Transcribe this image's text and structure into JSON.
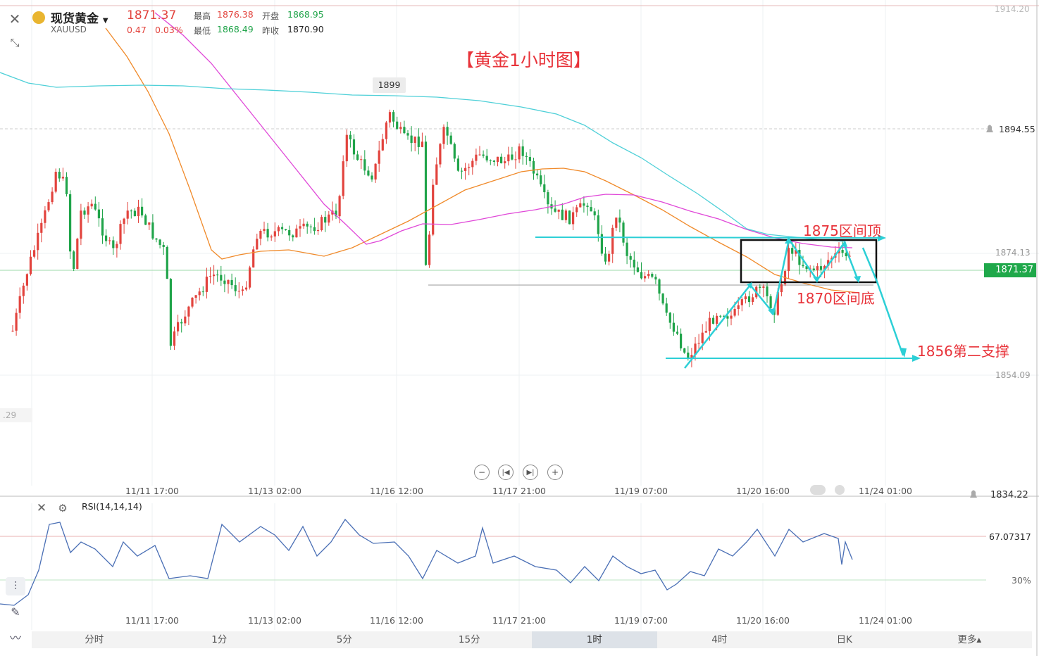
{
  "header": {
    "symbol_name": "现货黄金",
    "symbol_code": "XAUUSD",
    "last_price": "1871.37",
    "change": "0.47",
    "change_pct": "0.03%",
    "high_label": "最高",
    "high_value": "1876.38",
    "open_label": "开盘",
    "open_value": "1868.95",
    "low_label": "最低",
    "low_value": "1868.49",
    "prev_close_label": "昨收",
    "prev_close_value": "1870.90"
  },
  "annotations": {
    "title": "【黄金1小时图】",
    "resistance": "1875区间顶",
    "support": "1870区间底",
    "second_support": "1856第二支撑",
    "peak_tag": "1899",
    "left_tag": ".29"
  },
  "price_axis": {
    "top": "1914.20",
    "alert_level": "1894.55",
    "level_1": "1874.13",
    "current": "1871.37",
    "level_2": "1854.09",
    "bottom": "1834.22"
  },
  "time_axis": [
    "11/11 17:00",
    "11/13 02:00",
    "11/16 12:00",
    "11/17 21:00",
    "11/19 07:00",
    "11/20 16:00",
    "11/24 01:00"
  ],
  "rsi": {
    "title": "RSI(14,14,14)",
    "value": "67.07317",
    "level_label": "30%"
  },
  "tabs": [
    {
      "label": "分时",
      "active": false
    },
    {
      "label": "1分",
      "active": false
    },
    {
      "label": "5分",
      "active": false
    },
    {
      "label": "15分",
      "active": false
    },
    {
      "label": "1时",
      "active": true
    },
    {
      "label": "4时",
      "active": false
    },
    {
      "label": "日K",
      "active": false
    },
    {
      "label": "更多▴",
      "active": false
    }
  ],
  "colors": {
    "up": "#e2433d",
    "down": "#20a44a",
    "ma_orange": "#f08a2a",
    "ma_magenta": "#e048d8",
    "ma_cyan": "#4fd0d8",
    "annotation": "#e8333a",
    "arrow": "#2ccfd6",
    "rsi_line": "#4a6fb5"
  }
}
